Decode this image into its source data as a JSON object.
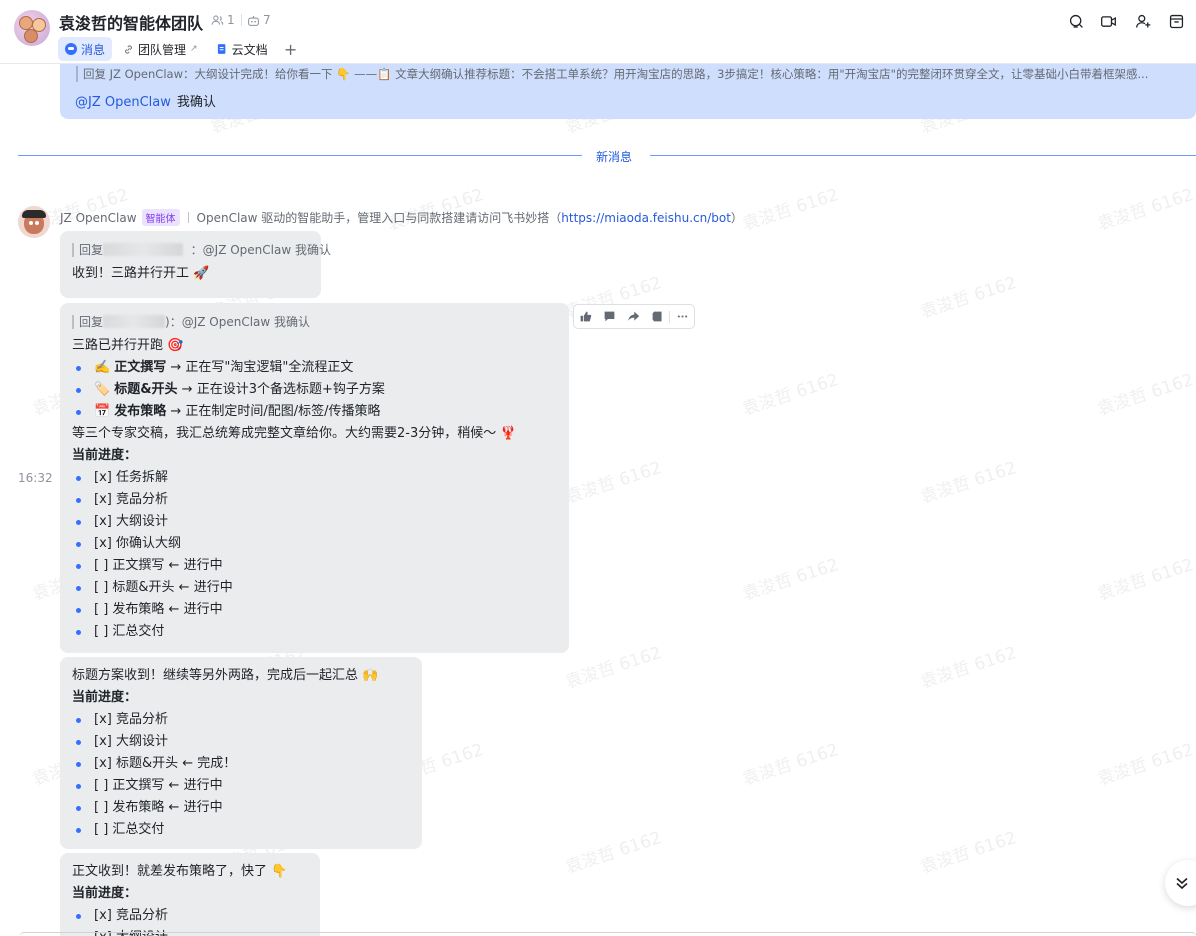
{
  "header": {
    "title": "袁浚哲的智能体团队",
    "member_count": "1",
    "bot_count": "7",
    "tabs": [
      {
        "label": "消息"
      },
      {
        "label": "团队管理"
      },
      {
        "label": "云文档"
      }
    ],
    "add_tab": "+"
  },
  "quote": {
    "text": "回复 JZ OpenClaw：大纲设计完成！给你看一下 👇 ——📋 文章大纲确认推荐标题：不会搭工单系统？用开淘宝店的思路，3步搞定！核心策略：用\"开淘宝店\"的完整闭环贯穿全文，让零基础小白带着框架感...",
    "mention": "@JZ OpenClaw",
    "body": "我确认"
  },
  "divider": {
    "label": "新消息"
  },
  "sender": {
    "name": "JZ OpenClaw",
    "badge": "智能体",
    "desc": "OpenClaw 驱动的智能助手，管理入口与同款搭建请访问飞书妙搭（",
    "link": "https://miaoda.feishu.cn/bot",
    "desc_end": "）"
  },
  "time": "16:32",
  "messages": [
    {
      "reply_prefix": "回复",
      "reply_suffix": "：@JZ OpenClaw 我确认",
      "text": "收到！三路并行开工 🚀"
    },
    {
      "reply_prefix": "回复",
      "reply_suffix": ")：@JZ OpenClaw 我确认",
      "intro": "三路已并行开跑 🎯",
      "tasks": [
        {
          "icon": "✍️",
          "name": "正文撰写",
          "rest": " → 正在写\"淘宝逻辑\"全流程正文"
        },
        {
          "icon": "🏷️",
          "name": "标题&开头",
          "rest": " → 正在设计3个备选标题+钩子方案"
        },
        {
          "icon": "📅",
          "name": "发布策略",
          "rest": " → 正在制定时间/配图/标签/传播策略"
        }
      ],
      "wait": "等三个专家交稿，我汇总统筹成完整文章给你。大约需要2-3分钟，稍候～ 🦞",
      "progress_label": "当前进度：",
      "progress": [
        "[x] 任务拆解",
        "[x] 竞品分析",
        "[x] 大纲设计",
        "[x] 你确认大纲",
        "[ ] 正文撰写 ← 进行中",
        "[ ] 标题&开头 ← 进行中",
        "[ ] 发布策略 ← 进行中",
        "[ ] 汇总交付"
      ]
    },
    {
      "intro": "标题方案收到！继续等另外两路，完成后一起汇总 🙌",
      "progress_label": "当前进度：",
      "progress": [
        "[x] 竞品分析",
        "[x] 大纲设计",
        "[x] 标题&开头 ← 完成！",
        "[ ] 正文撰写 ← 进行中",
        "[ ] 发布策略 ← 进行中",
        "[ ] 汇总交付"
      ]
    },
    {
      "intro": "正文收到！就差发布策略了，快了 👇",
      "progress_label": "当前进度：",
      "progress": [
        "[x] 竞品分析",
        "[x] 大纲设计"
      ]
    }
  ],
  "watermark": "袁浚哲 6162",
  "colors": {
    "accent": "#3370ff",
    "link": "#245bdb",
    "bubble": "#ebecee",
    "quote_bg": "#cfdefd",
    "bot_badge": "#7f3bf5"
  }
}
